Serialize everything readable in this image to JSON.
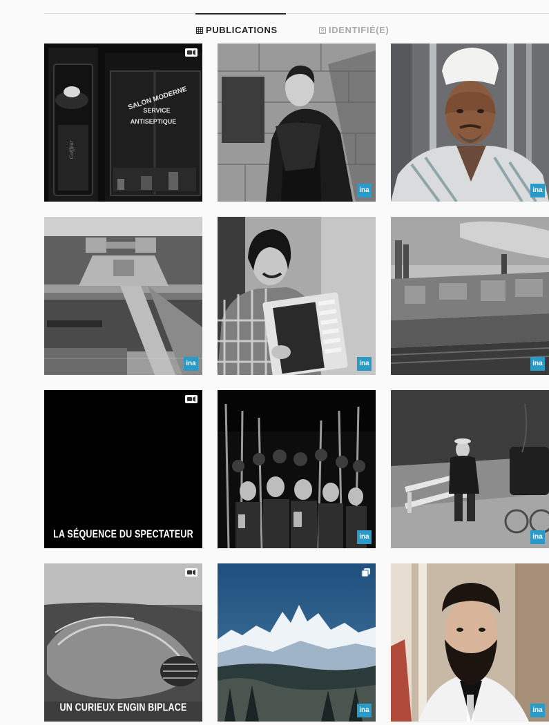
{
  "tabs": {
    "publications": {
      "label": "PUBLICATIONS",
      "icon": "grid-icon",
      "active": true
    },
    "identified": {
      "label": "IDENTIFIÉ(E)",
      "icon": "tagged-user-icon",
      "active": false
    }
  },
  "badge_label": "ina",
  "colors": {
    "accent_text": "#262626",
    "muted_text": "#a8a8a8",
    "ina_badge": "#2a9bc7",
    "background": "#fafafa"
  },
  "posts": [
    {
      "subject": "storefront-salon-moderne",
      "media": "video",
      "shop_sign": [
        "SALON MODERNE",
        "SERVICE",
        "ANTISEPTIQUE"
      ],
      "door_sign": "Coiffeur"
    },
    {
      "subject": "man-in-dark-coat-and-scarf",
      "media": "photo",
      "badge": true
    },
    {
      "subject": "man-with-white-cap",
      "media": "photo",
      "badge": true
    },
    {
      "subject": "trocadero-aerial-view",
      "media": "photo",
      "badge": true
    },
    {
      "subject": "accordion-player",
      "media": "photo",
      "badge": true
    },
    {
      "subject": "paris-rooftops",
      "media": "photo",
      "badge": true
    },
    {
      "subject": "black-title-card",
      "media": "video",
      "caption": "LA SÉQUENCE DU SPECTATEUR"
    },
    {
      "subject": "skiers-crowd",
      "media": "photo",
      "badge": true
    },
    {
      "subject": "boy-on-bench-with-pram",
      "media": "photo",
      "badge": true
    },
    {
      "subject": "biplace-car",
      "media": "video",
      "caption": "UN CURIEUX ENGIN BIPLACE"
    },
    {
      "subject": "snowy-mountains",
      "media": "carousel",
      "badge": true
    },
    {
      "subject": "bearded-man-portrait",
      "media": "photo",
      "badge": true
    }
  ]
}
